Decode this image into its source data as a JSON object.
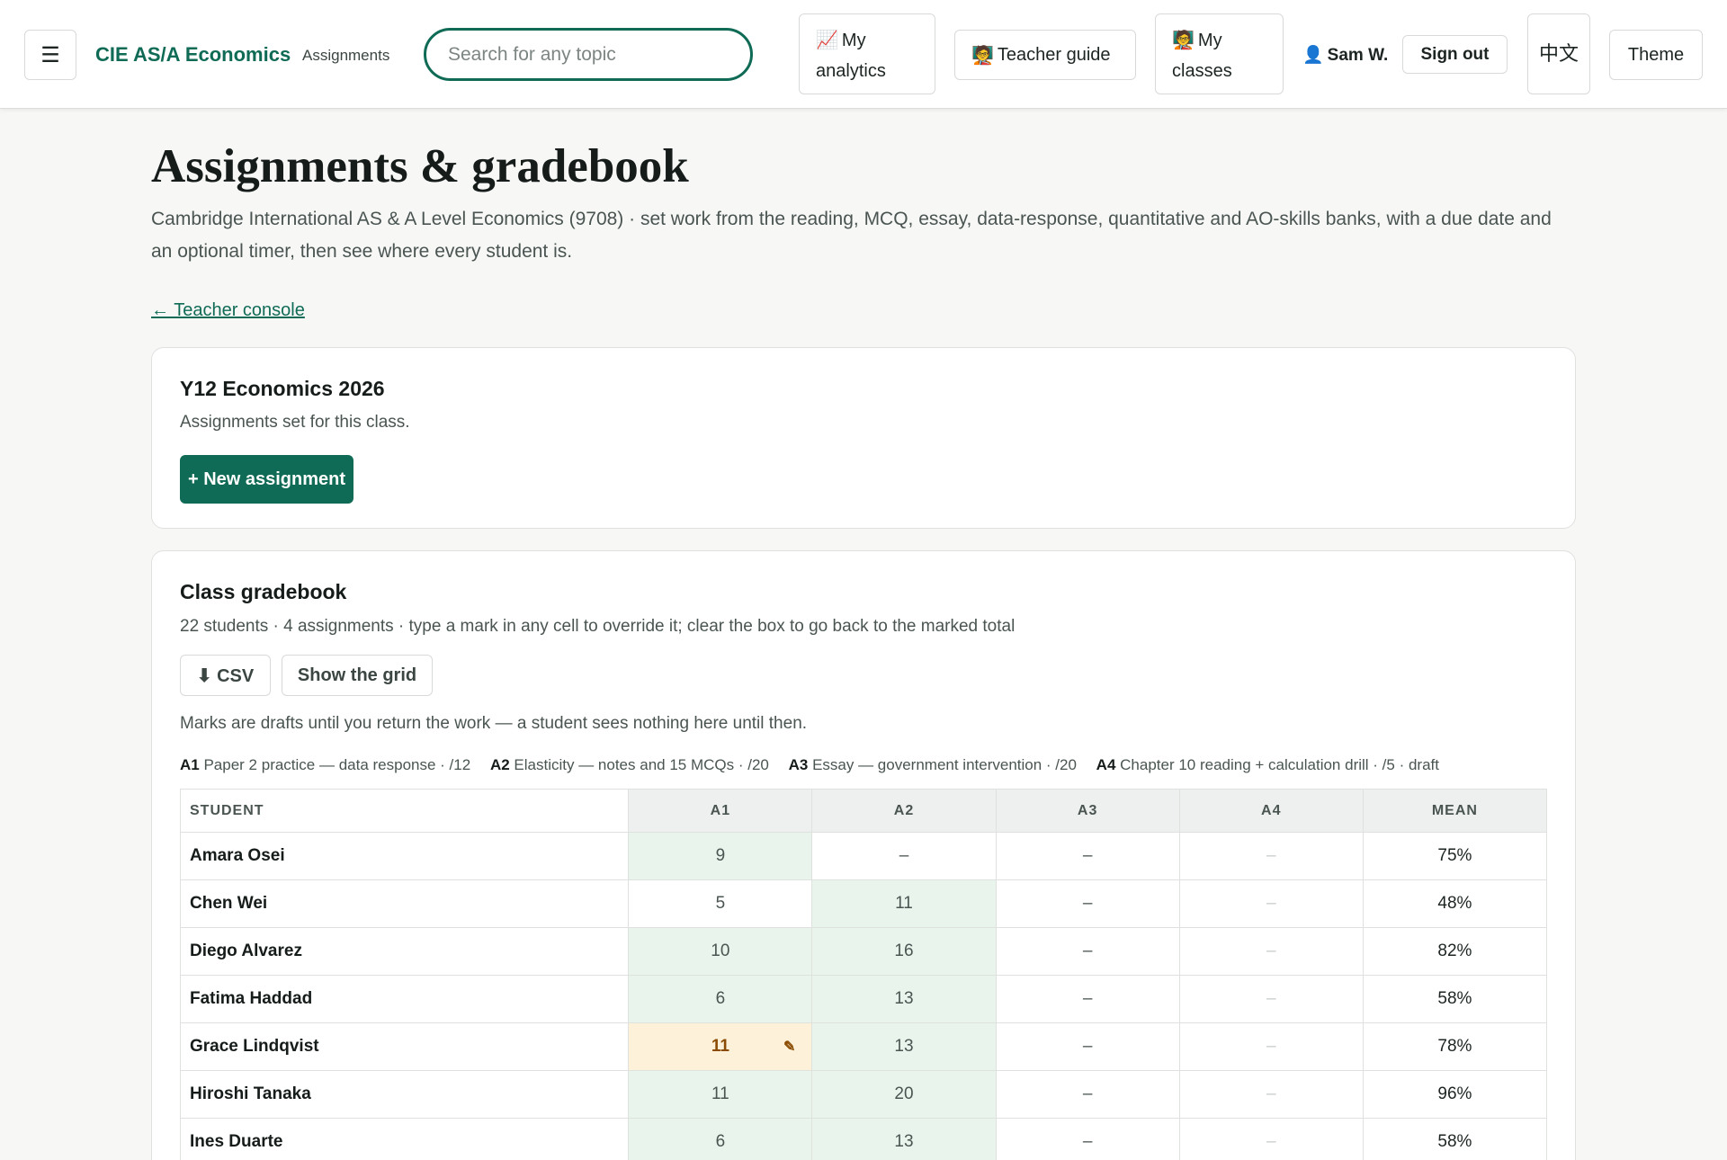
{
  "header": {
    "menu_icon": "☰",
    "brand": "CIE AS/A Economics",
    "brand_sub": "Assignments",
    "search_placeholder": "Search for any topic",
    "analytics_emoji": "📈",
    "analytics_line1": "My",
    "analytics_line2": "analytics",
    "guide_emoji": "🧑‍🏫",
    "guide_label": "Teacher guide",
    "classes_emoji": "🧑‍🏫",
    "classes_line1": "My",
    "classes_line2": "classes",
    "user_icon": "👤",
    "user_name": "Sam W.",
    "signout_label": "Sign out",
    "lang_line1": "中",
    "lang_line2": "文",
    "theme_label": "Theme"
  },
  "page": {
    "title": "Assignments & gradebook",
    "description": "Cambridge International AS & A Level Economics (9708) · set work from the reading, MCQ, essay, data-response, quantitative and AO-skills banks, with a due date and an optional timer, then see where every student is.",
    "back_link": "← Teacher console"
  },
  "class_card": {
    "title": "Y12 Economics 2026",
    "subtitle": "Assignments set for this class.",
    "new_button": "+ New assignment"
  },
  "gradebook": {
    "title": "Class gradebook",
    "subtitle": "22 students · 4 assignments · type a mark in any cell to override it; clear the box to go back to the marked total",
    "csv_button": "⬇ CSV",
    "grid_button": "Show the grid",
    "note": "Marks are drafts until you return the work — a student sees nothing here until then.",
    "legend": [
      {
        "code": "A1",
        "text": "Paper 2 practice — data response · /12"
      },
      {
        "code": "A2",
        "text": "Elasticity — notes and 15 MCQs · /20"
      },
      {
        "code": "A3",
        "text": "Essay — government intervention · /20"
      },
      {
        "code": "A4",
        "text": "Chapter 10 reading + calculation drill · /5 · draft"
      }
    ],
    "columns": [
      "STUDENT",
      "A1",
      "A2",
      "A3",
      "A4",
      "MEAN"
    ],
    "rows": [
      {
        "name": "Amara Osei",
        "a1": "9",
        "a2": "–",
        "a3": "–",
        "a4": "–",
        "mean": "75%"
      },
      {
        "name": "Chen Wei",
        "a1": "5",
        "a2": "11",
        "a3": "–",
        "a4": "–",
        "mean": "48%"
      },
      {
        "name": "Diego Alvarez",
        "a1": "10",
        "a2": "16",
        "a3": "–",
        "a4": "–",
        "mean": "82%"
      },
      {
        "name": "Fatima Haddad",
        "a1": "6",
        "a2": "13",
        "a3": "–",
        "a4": "–",
        "mean": "58%"
      },
      {
        "name": "Grace Lindqvist",
        "a1": "11",
        "a2": "13",
        "a3": "–",
        "a4": "–",
        "mean": "78%",
        "a1_override_icon": "✎"
      },
      {
        "name": "Hiroshi Tanaka",
        "a1": "11",
        "a2": "20",
        "a3": "–",
        "a4": "–",
        "mean": "96%"
      },
      {
        "name": "Ines Duarte",
        "a1": "6",
        "a2": "13",
        "a3": "–",
        "a4": "–",
        "mean": "58%"
      }
    ]
  },
  "colors": {
    "accent": "#0f6b55",
    "marked_cell": "#e8f4ec",
    "override_cell": "#fdf2d9",
    "override_text": "#8a4b00"
  }
}
